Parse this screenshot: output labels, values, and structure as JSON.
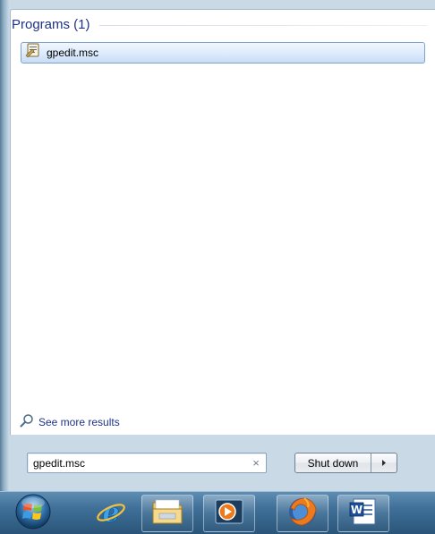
{
  "start_menu": {
    "results_group_title": "Programs (1)",
    "result_item": {
      "label": "gpedit.msc",
      "icon": "msc-console-icon"
    },
    "see_more_label": "See more results",
    "search": {
      "value": "gpedit.msc",
      "clear_glyph": "×"
    },
    "shutdown_label": "Shut down",
    "shutdown_arrow_glyph": "▸"
  },
  "taskbar": {
    "items": [
      {
        "name": "start-orb",
        "icon": "windows-logo-icon"
      },
      {
        "name": "internet-explorer",
        "icon": "internet-explorer-icon"
      },
      {
        "name": "windows-explorer",
        "icon": "folder-icon"
      },
      {
        "name": "media-player",
        "icon": "media-player-icon"
      },
      {
        "name": "firefox",
        "icon": "firefox-icon"
      },
      {
        "name": "microsoft-word",
        "icon": "word-icon"
      }
    ]
  },
  "colors": {
    "accent_text": "#1e3287",
    "highlight_border": "#7da2ce",
    "taskbar": "#3f6f98"
  }
}
